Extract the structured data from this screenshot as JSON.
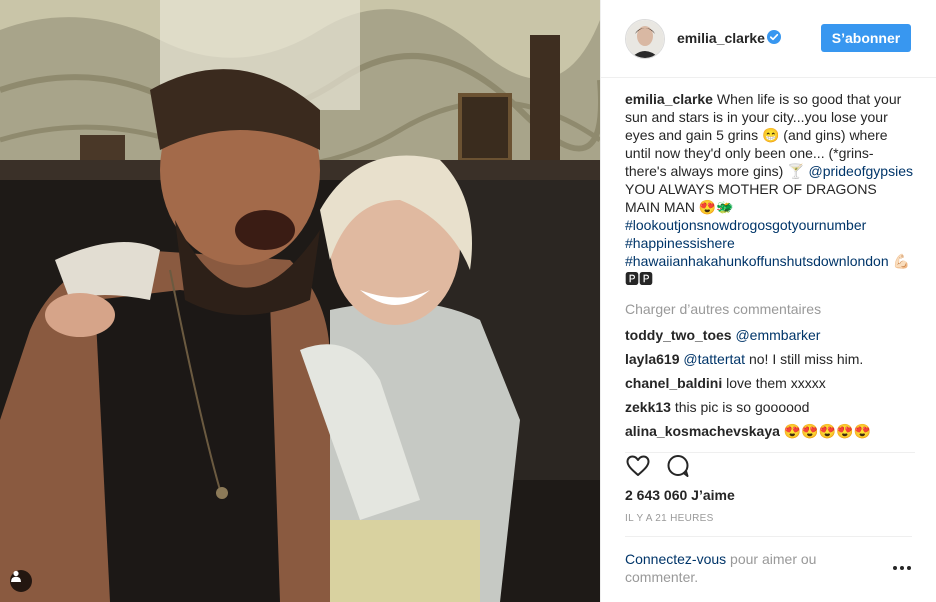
{
  "post": {
    "photo": {
      "alt_icon": "user-tag-icon"
    },
    "header": {
      "username": "emilia_clarke",
      "verified": true,
      "follow_label": "S’abonner"
    },
    "caption": {
      "username": "emilia_clarke",
      "text_1": " When life is so good that your sun and stars is in your city...you lose your eyes and gain 5 grins 😁 (and gins) where until now they'd only been one... (*grins- there's always more gins) 🍸 ",
      "mention": "@prideofgypsies",
      "text_2": " YOU ALWAYS MOTHER OF DRAGONS MAIN MAN 😍🐲 ",
      "hashtags": [
        "#lookoutjonsnowdrogosgotyournumber",
        "#happinessishere",
        "#hawaiianhakahunkoffunshutsdownlondon"
      ],
      "tail": " 💪🏻🅿🅿"
    },
    "load_more": "Charger d’autres commentaires",
    "comments": [
      {
        "username": "toddy_two_toes",
        "mention": "@emmbarker",
        "text": ""
      },
      {
        "username": "layla619",
        "mention": "@tattertat",
        "text": " no! I still miss him."
      },
      {
        "username": "chanel_baldini",
        "mention": "",
        "text": " love them xxxxx"
      },
      {
        "username": "zekk13",
        "mention": "",
        "text": " this pic is so goooood"
      },
      {
        "username": "alina_kosmachevskaya",
        "mention": "",
        "text": " 😍😍😍😍😍"
      }
    ],
    "actions": {
      "like_icon": "heart-icon",
      "comment_icon": "comment-icon"
    },
    "likes": "2 643 060 J’aime",
    "timestamp": "IL Y A 21 HEURES",
    "login": {
      "link": "Connectez-vous",
      "rest": " pour aimer ou commenter."
    },
    "more_icon": "more-options-icon",
    "colors": {
      "accent": "#3897f0",
      "link": "#003569",
      "muted": "#999999",
      "border": "#efefef"
    }
  }
}
